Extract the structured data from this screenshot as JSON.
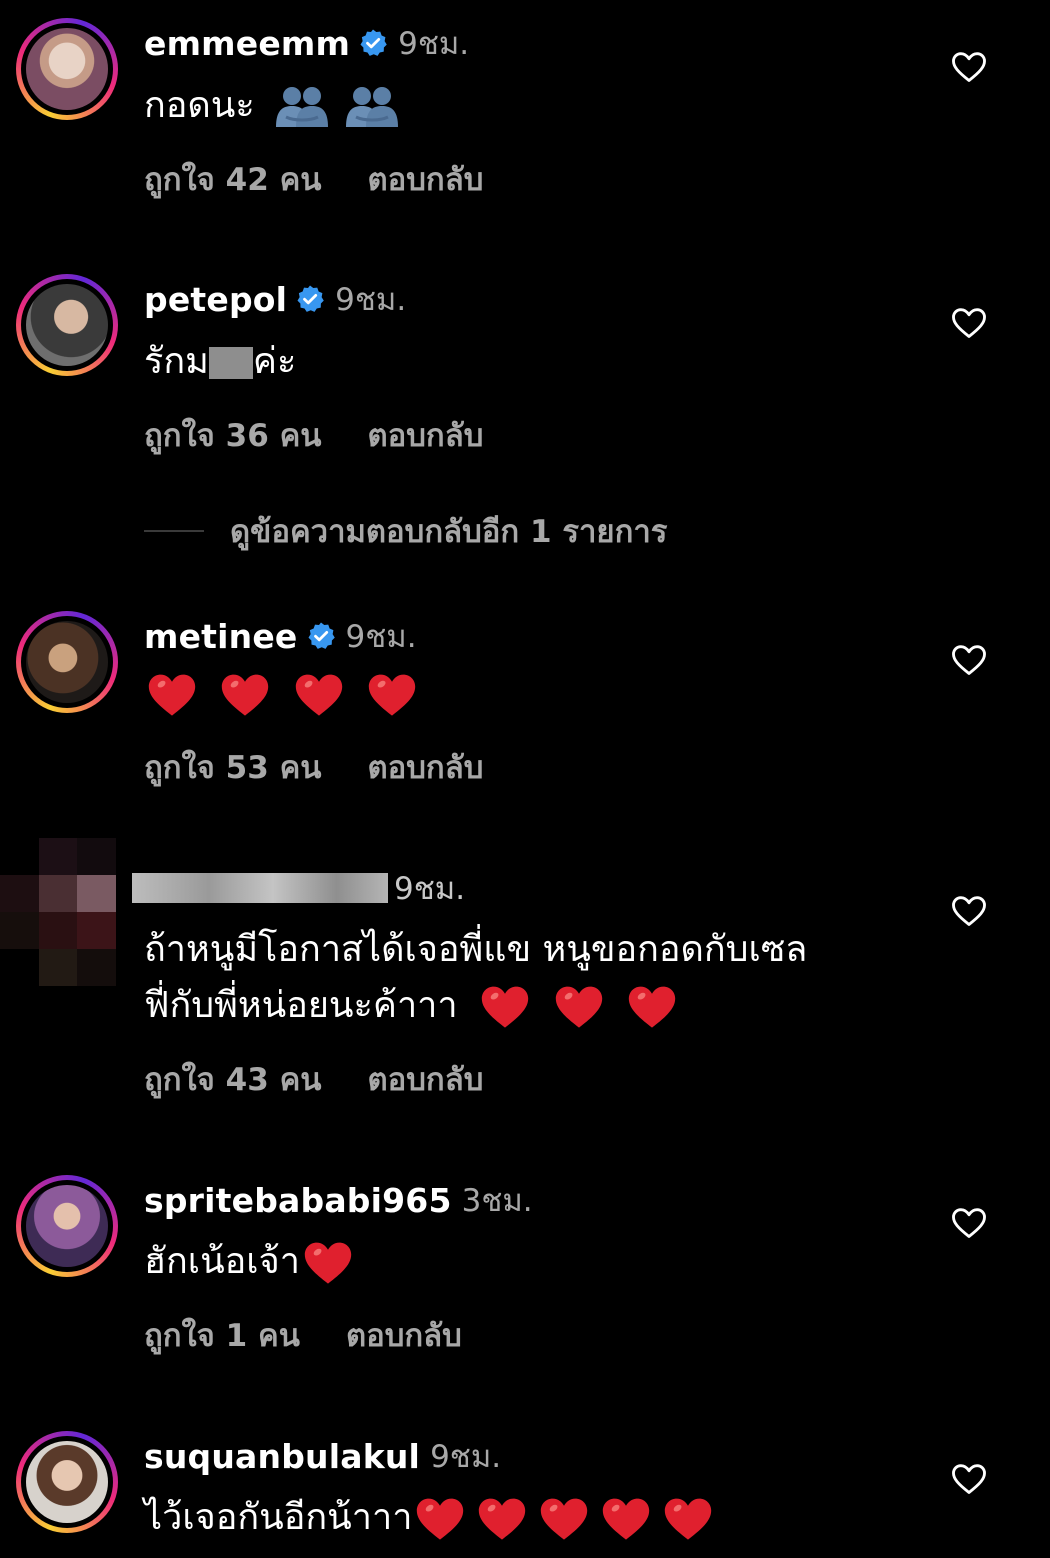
{
  "comments": [
    {
      "username": "emmeemm",
      "verified": true,
      "time": "9ชม.",
      "text": "กอดนะ",
      "emoji": [
        "people-hugging",
        "people-hugging"
      ],
      "likes": "ถูกใจ 42 คน",
      "reply": "ตอบกลับ"
    },
    {
      "username": "petepol",
      "verified": true,
      "time": "9ชม.",
      "text_before": "รักม",
      "text_after": "ค่ะ",
      "likes": "ถูกใจ 36 คน",
      "reply": "ตอบกลับ"
    },
    {
      "username": "metinee",
      "verified": true,
      "time": "9ชม.",
      "text": "",
      "emoji": [
        "red-heart",
        "red-heart",
        "red-heart",
        "red-heart"
      ],
      "likes": "ถูกใจ 53 คน",
      "reply": "ตอบกลับ"
    },
    {
      "username": "",
      "verified": false,
      "time": "9ชม.",
      "text_line1": "ถ้าหนูมีโอกาสได้เจอพี่แข หนูขอกอดกับเซล",
      "text_line2": "ฟี่กับพี่หน่อยนะค้าาา",
      "emoji": [
        "red-heart",
        "red-heart",
        "red-heart"
      ],
      "likes": "ถูกใจ 43 คน",
      "reply": "ตอบกลับ"
    },
    {
      "username": "spritebababi965",
      "verified": false,
      "time": "3ชม.",
      "text": "ฮักเน้อเจ้า",
      "emoji": [
        "red-heart"
      ],
      "likes": "ถูกใจ 1 คน",
      "reply": "ตอบกลับ"
    },
    {
      "username": "suquanbulakul",
      "verified": false,
      "time": "9ชม.",
      "text": "ไว้เจอกันอีกน้าาา",
      "emoji": [
        "red-heart",
        "red-heart",
        "red-heart",
        "red-heart",
        "red-heart"
      ]
    }
  ],
  "view_replies": "ดูข้อความตอบกลับอีก 1 รายการ",
  "colors": {
    "background": "#000000",
    "primary_text": "#ffffff",
    "secondary_text": "#a8a8a8",
    "verified_blue": "#3897f0",
    "heart_red": "#e0202e"
  }
}
